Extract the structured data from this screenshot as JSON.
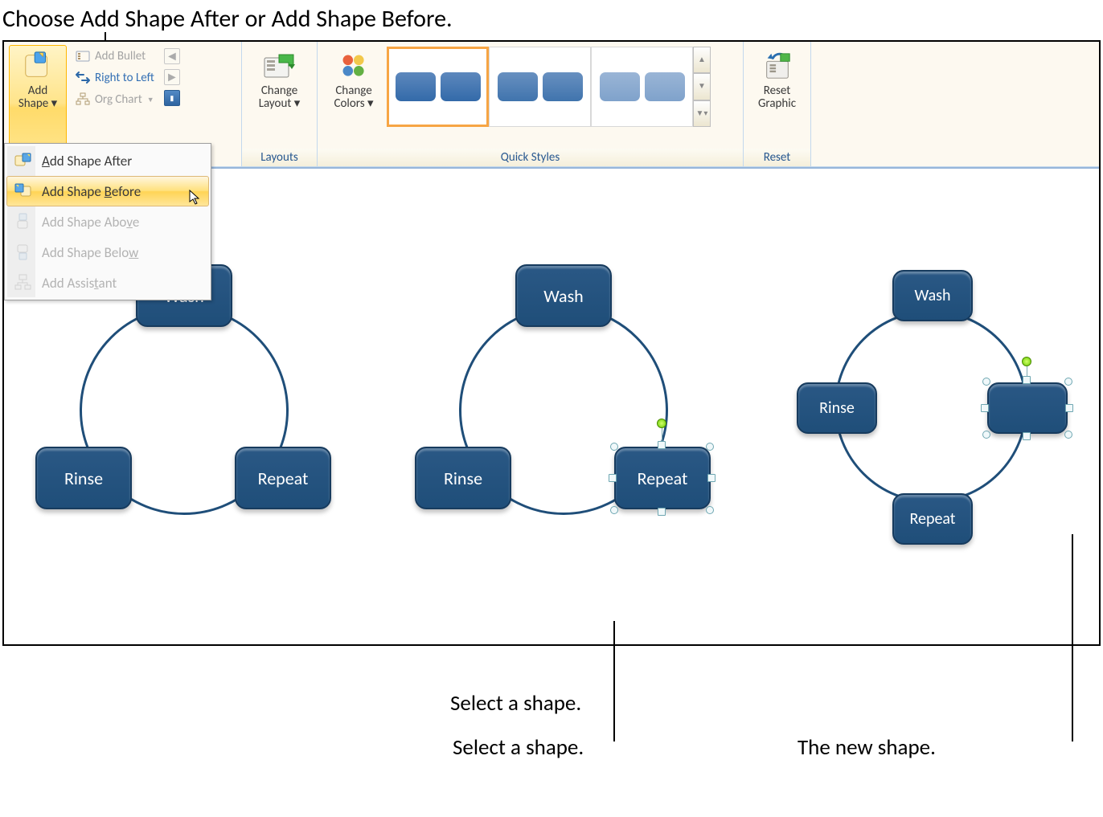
{
  "topCallout": "Choose Add Shape After or Add Shape Before.",
  "ribbon": {
    "addShapeLabel": "Add\nShape",
    "addBullet": "Add Bullet",
    "rightToLeft": "Right to Left",
    "orgChart": "Org Chart",
    "changeLayout": "Change\nLayout",
    "changeColors": "Change\nColors",
    "resetGraphic": "Reset\nGraphic",
    "groups": {
      "layouts": "Layouts",
      "quickStyles": "Quick Styles",
      "reset": "Reset"
    }
  },
  "dropdown": {
    "after": "Add Shape After",
    "before": "Add Shape Before",
    "above": "Add Shape Above",
    "below": "Add Shape Below",
    "assistant": "Add Assistant"
  },
  "diagram": {
    "wash": "Wash",
    "rinse": "Rinse",
    "repeat": "Repeat",
    "blank": ""
  },
  "bottomCallouts": {
    "select": "Select a shape.",
    "new": "The new shape."
  }
}
